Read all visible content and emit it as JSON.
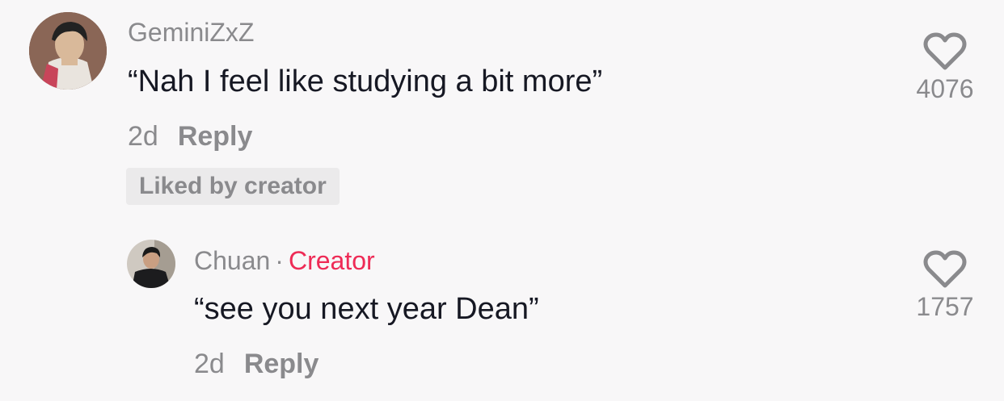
{
  "comments": [
    {
      "username": "GeminiZxZ",
      "text": "“Nah I feel like studying a bit more”",
      "age": "2d",
      "reply_label": "Reply",
      "liked_label": "Liked by creator",
      "like_count": "4076",
      "avatar_icon": "avatar-anime-character"
    },
    {
      "username": "Chuan",
      "separator": "·",
      "badge": "Creator",
      "text": "“see you next year Dean”",
      "age": "2d",
      "reply_label": "Reply",
      "like_count": "1757",
      "avatar_icon": "avatar-photo"
    }
  ],
  "colors": {
    "background": "#f8f7f8",
    "secondary_text": "#8a8a8d",
    "primary_text": "#161823",
    "creator_badge": "#ee2b56"
  },
  "icons": {
    "like": "heart-outline-icon"
  }
}
